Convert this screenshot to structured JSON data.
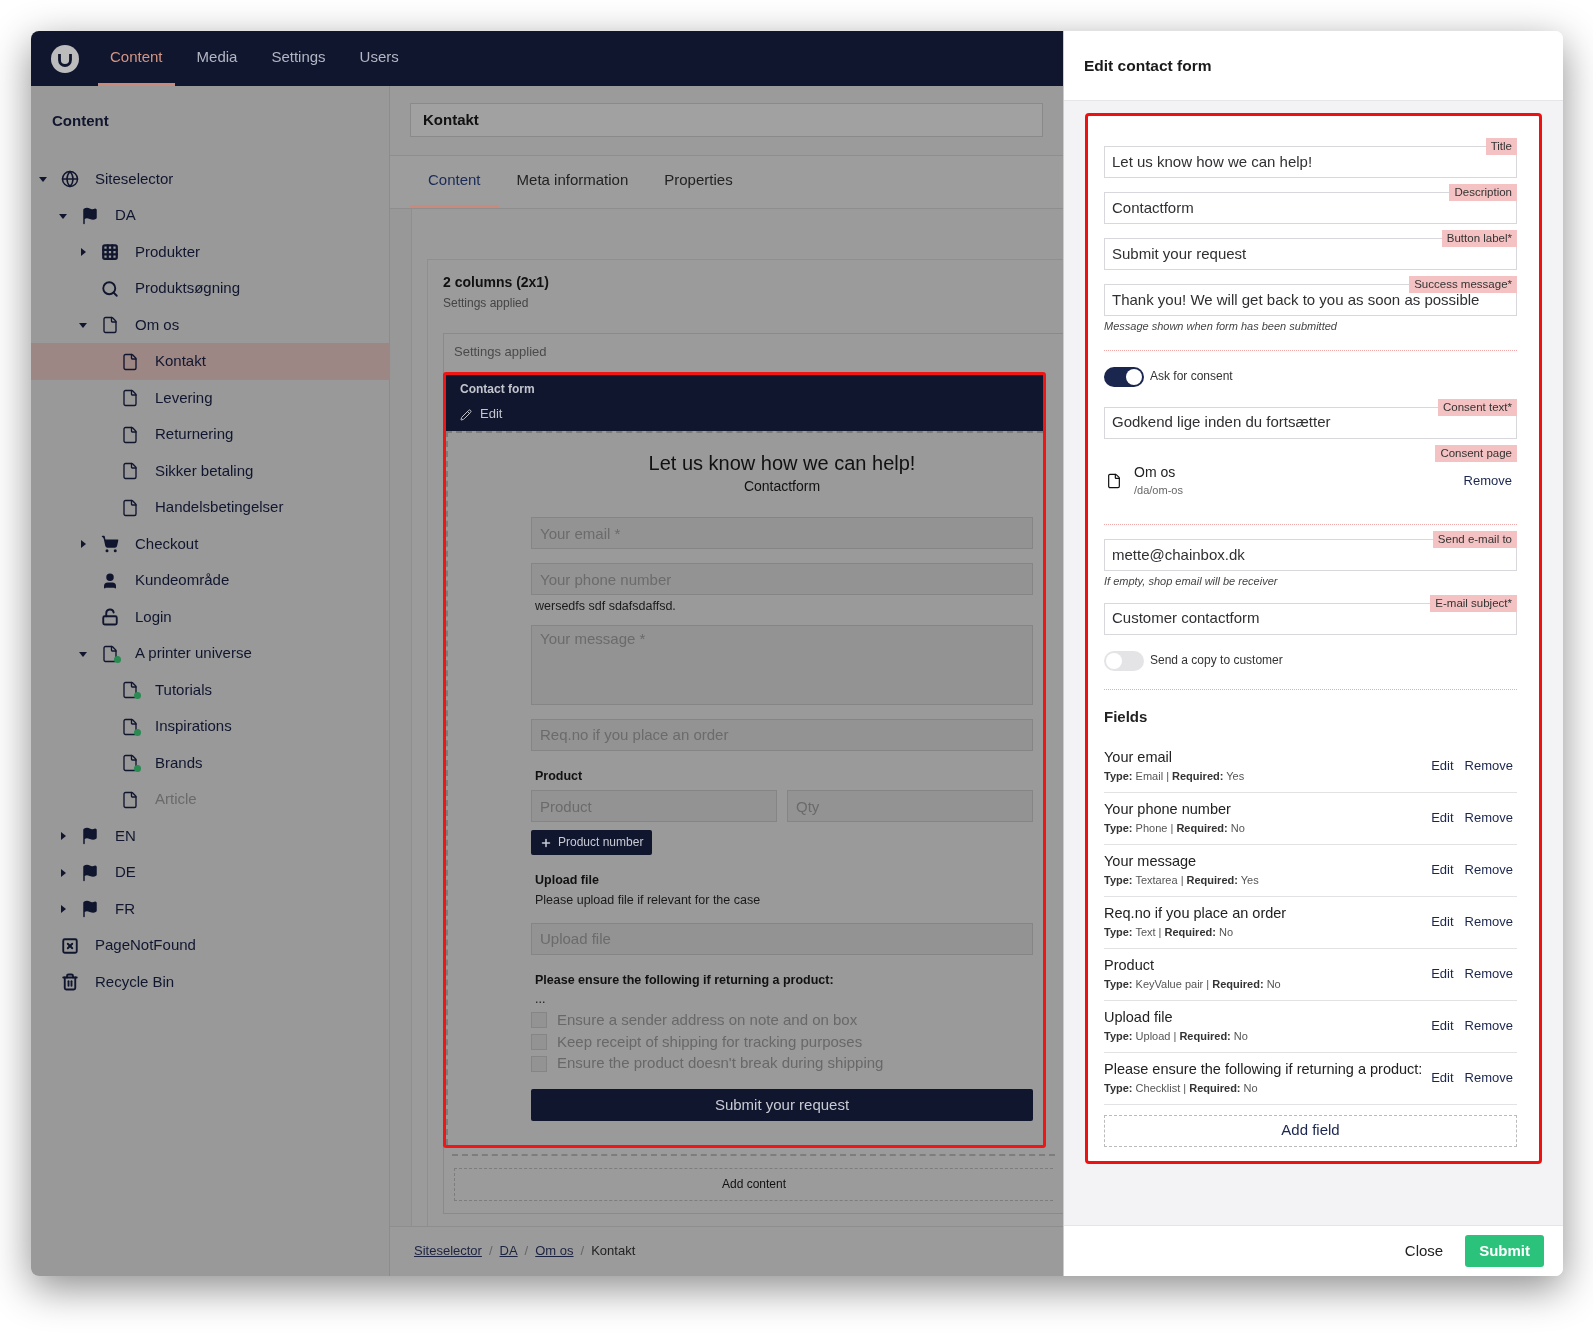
{
  "topbar": {
    "sections": [
      {
        "label": "Content",
        "selected": true
      },
      {
        "label": "Media",
        "selected": false
      },
      {
        "label": "Settings",
        "selected": false
      },
      {
        "label": "Users",
        "selected": false
      }
    ]
  },
  "sidebar": {
    "title": "Content",
    "tree": [
      {
        "label": "Siteselector",
        "kind": "site",
        "selected": false,
        "published": true,
        "expanded": true,
        "children": [
          {
            "label": "DA",
            "kind": "language",
            "selected": false,
            "published": true,
            "expanded": true,
            "children": [
              {
                "label": "Produkter",
                "kind": "grid",
                "selected": false,
                "published": true,
                "expanded": false
              },
              {
                "label": "Produktsøgning",
                "kind": "search",
                "selected": false,
                "published": true
              },
              {
                "label": "Om os",
                "kind": "page",
                "selected": false,
                "published": true,
                "expanded": true,
                "children": [
                  {
                    "label": "Kontakt",
                    "kind": "page",
                    "selected": true,
                    "published": true
                  },
                  {
                    "label": "Levering",
                    "kind": "page",
                    "selected": false,
                    "published": true
                  },
                  {
                    "label": "Returnering",
                    "kind": "page",
                    "selected": false,
                    "published": true
                  },
                  {
                    "label": "Sikker betaling",
                    "kind": "page",
                    "selected": false,
                    "published": true
                  },
                  {
                    "label": "Handelsbetingelser",
                    "kind": "page",
                    "selected": false,
                    "published": true
                  }
                ]
              },
              {
                "label": "Checkout",
                "kind": "cart",
                "selected": false,
                "published": true,
                "expanded": false
              },
              {
                "label": "Kundeområde",
                "kind": "user",
                "selected": false,
                "published": true
              },
              {
                "label": "Login",
                "kind": "lock",
                "selected": false,
                "published": true
              },
              {
                "label": "A printer universe",
                "kind": "blueprint",
                "selected": false,
                "published": true,
                "expanded": true,
                "children": [
                  {
                    "label": "Tutorials",
                    "kind": "blueprint",
                    "selected": false,
                    "published": true
                  },
                  {
                    "label": "Inspirations",
                    "kind": "blueprint",
                    "selected": false,
                    "published": true
                  },
                  {
                    "label": "Brands",
                    "kind": "blueprint",
                    "selected": false,
                    "published": true
                  },
                  {
                    "label": "Article",
                    "kind": "page",
                    "selected": false,
                    "published": false
                  }
                ]
              }
            ]
          },
          {
            "label": "EN",
            "kind": "language",
            "selected": false,
            "published": true,
            "expanded": false
          },
          {
            "label": "DE",
            "kind": "language",
            "selected": false,
            "published": true,
            "expanded": false
          },
          {
            "label": "FR",
            "kind": "language",
            "selected": false,
            "published": true,
            "expanded": false
          }
        ]
      },
      {
        "label": "PageNotFound",
        "kind": "notfound",
        "selected": false,
        "published": true
      },
      {
        "label": "Recycle Bin",
        "kind": "bin",
        "selected": false,
        "published": true
      }
    ]
  },
  "editor": {
    "name": "Kontakt",
    "tabs": [
      {
        "label": "Content",
        "selected": true
      },
      {
        "label": "Meta information",
        "selected": false
      },
      {
        "label": "Properties",
        "selected": false
      }
    ],
    "layout": {
      "title": "2 columns (2x1)",
      "subtitle": "Settings applied",
      "area_label": "Settings applied",
      "block": {
        "title": "Contact form",
        "edit": "Edit",
        "preview": {
          "title": "Let us know how we can help!",
          "description": "Contactform",
          "items": [
            {
              "kind": "input",
              "placeholder": "Your email *"
            },
            {
              "kind": "input",
              "placeholder": "Your phone number"
            },
            {
              "kind": "text",
              "text": "wersedfs sdf sdafsdaffsd."
            },
            {
              "kind": "textarea",
              "placeholder": "Your message *"
            },
            {
              "kind": "input",
              "placeholder": "Req.no if you place an order"
            },
            {
              "kind": "heading",
              "text": "Product"
            },
            {
              "kind": "pair",
              "placeholders": [
                "Product",
                "Qty"
              ]
            },
            {
              "kind": "add_button",
              "label": "Product number"
            },
            {
              "kind": "heading",
              "text": "Upload file"
            },
            {
              "kind": "text",
              "text": "Please upload file if relevant for the case"
            },
            {
              "kind": "input",
              "placeholder": "Upload file"
            },
            {
              "kind": "heading",
              "text": "Please ensure the following if returning a product:"
            },
            {
              "kind": "text",
              "text": "..."
            },
            {
              "kind": "checkbox",
              "label": "Ensure a sender address on note and on box",
              "checked": false
            },
            {
              "kind": "checkbox",
              "label": "Keep receipt of shipping for tracking purposes",
              "checked": false
            },
            {
              "kind": "checkbox",
              "label": "Ensure the product doesn't break during shipping",
              "checked": false
            },
            {
              "kind": "submit",
              "label": "Submit your request"
            }
          ]
        }
      },
      "add_content": "Add content"
    },
    "breadcrumb": [
      {
        "label": "Siteselector",
        "link": true
      },
      {
        "label": "DA",
        "link": true
      },
      {
        "label": "Om os",
        "link": true
      },
      {
        "label": "Kontakt",
        "link": false
      }
    ],
    "breadcrumb_separator": "/"
  },
  "dialog": {
    "title": "Edit contact form",
    "settings": [
      {
        "kind": "field",
        "label": "Title",
        "value": "Let us know how we can help!"
      },
      {
        "kind": "field",
        "label": "Description",
        "value": "Contactform"
      },
      {
        "kind": "field",
        "label": "Button label*",
        "value": "Submit your request"
      },
      {
        "kind": "field",
        "label": "Success message*",
        "value": "Thank you! We will get back to you as soon as possible",
        "hint": "Message shown when form has been submitted"
      },
      {
        "kind": "separator"
      },
      {
        "kind": "toggle",
        "label": "Ask for consent",
        "on": true
      },
      {
        "kind": "field",
        "label": "Consent text*",
        "value": "Godkend lige inden du fortsætter"
      },
      {
        "kind": "page",
        "label": "Consent page",
        "name": "Om os",
        "path": "/da/om-os",
        "action": "Remove"
      },
      {
        "kind": "separator"
      },
      {
        "kind": "field",
        "label": "Send e-mail to",
        "value": "mette@chainbox.dk",
        "hint": "If empty, shop email will be receiver"
      },
      {
        "kind": "field",
        "label": "E-mail subject*",
        "value": "Customer contactform"
      },
      {
        "kind": "toggle",
        "label": "Send a copy to customer",
        "on": false
      },
      {
        "kind": "separator"
      }
    ],
    "fields_title": "Fields",
    "fields": [
      {
        "name": "Your email",
        "meta": "**Type:** Email | **Required:** Yes",
        "edit": "Edit",
        "remove": "Remove"
      },
      {
        "name": "Your phone number",
        "meta": "**Type:** Phone | **Required:** No",
        "edit": "Edit",
        "remove": "Remove"
      },
      {
        "name": "Your message",
        "meta": "**Type:** Textarea | **Required:** Yes",
        "edit": "Edit",
        "remove": "Remove"
      },
      {
        "name": "Req.no if you place an order",
        "meta": "**Type:** Text | **Required:** No",
        "edit": "Edit",
        "remove": "Remove"
      },
      {
        "name": "Product",
        "meta": "**Type:** KeyValue pair | **Required:** No",
        "edit": "Edit",
        "remove": "Remove"
      },
      {
        "name": "Upload file",
        "meta": "**Type:** Upload | **Required:** No",
        "edit": "Edit",
        "remove": "Remove"
      },
      {
        "name": "Please ensure the following if returning a product:",
        "meta": "**Type:** Checklist | **Required:** No",
        "edit": "Edit",
        "remove": "Remove"
      }
    ],
    "add_field": "Add field",
    "close": "Close",
    "submit": "Submit"
  }
}
